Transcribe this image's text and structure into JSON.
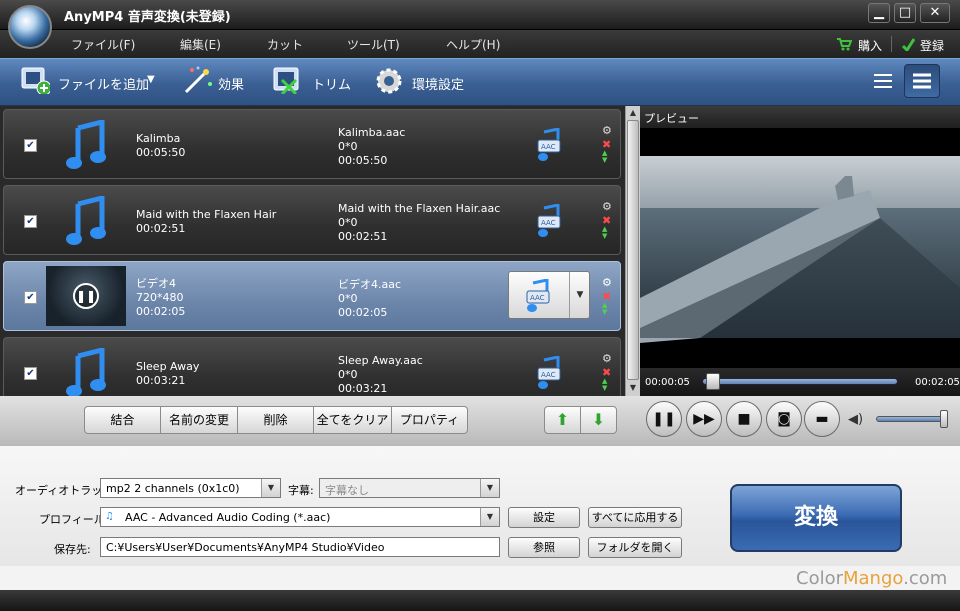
{
  "window": {
    "title": "AnyMP4 音声変換(未登録)",
    "minimize": "▁",
    "maximize": "□",
    "close": "✕"
  },
  "menu": {
    "items": [
      "ファイル(F)",
      "編集(E)",
      "カット",
      "ツール(T)",
      "ヘルプ(H)"
    ],
    "buy": "購入",
    "login": "登録"
  },
  "toolbar": {
    "add_file": "ファイルを追加",
    "effect": "効果",
    "trim": "トリム",
    "preferences": "環境設定"
  },
  "files": [
    {
      "name": "Kalimba",
      "duration": "00:05:50",
      "out_name": "Kalimba.aac",
      "out_size": "0*0",
      "out_duration": "00:05:50",
      "checked": true,
      "type": "audio"
    },
    {
      "name": "Maid with the Flaxen Hair",
      "duration": "00:02:51",
      "out_name": "Maid with the Flaxen Hair.aac",
      "out_size": "0*0",
      "out_duration": "00:02:51",
      "checked": true,
      "type": "audio"
    },
    {
      "name": "ビデオ4",
      "resolution": "720*480",
      "duration": "00:02:05",
      "out_name": "ビデオ4.aac",
      "out_size": "0*0",
      "out_duration": "00:02:05",
      "checked": true,
      "type": "video",
      "selected": true
    },
    {
      "name": "Sleep Away",
      "duration": "00:03:21",
      "out_name": "Sleep Away.aac",
      "out_size": "0*0",
      "out_duration": "00:03:21",
      "checked": true,
      "type": "audio"
    }
  ],
  "format_icon_label": "AAC",
  "actions": {
    "merge": "結合",
    "rename": "名前の変更",
    "delete": "削除",
    "clear_all": "全てをクリア",
    "properties": "プロパティ"
  },
  "preview": {
    "label": "プレビュー",
    "current_time": "00:00:05",
    "total_time": "00:02:05",
    "progress": 0.04,
    "volume": 0.95
  },
  "settings": {
    "audio_track_label": "オーディオトラック:",
    "audio_track_value": "mp2 2 channels (0x1c0)",
    "subtitle_label": "字幕:",
    "subtitle_value": "字幕なし",
    "profile_label": "プロフィール:",
    "profile_value": "AAC - Advanced Audio Coding (*.aac)",
    "settings_button": "設定",
    "apply_all_button": "すべてに応用する",
    "save_label": "保存先:",
    "save_path": "C:¥Users¥User¥Documents¥AnyMP4 Studio¥Video",
    "browse_button": "参照",
    "open_folder_button": "フォルダを開く"
  },
  "convert_button": "変換",
  "watermark": {
    "a": "Color",
    "b": "Mango",
    "c": ".com"
  },
  "colors": {
    "toolbar": "#3a5f93",
    "selected_row": "#6c86aa",
    "convert": "#2a559b",
    "accent_green": "#3aa63a"
  }
}
